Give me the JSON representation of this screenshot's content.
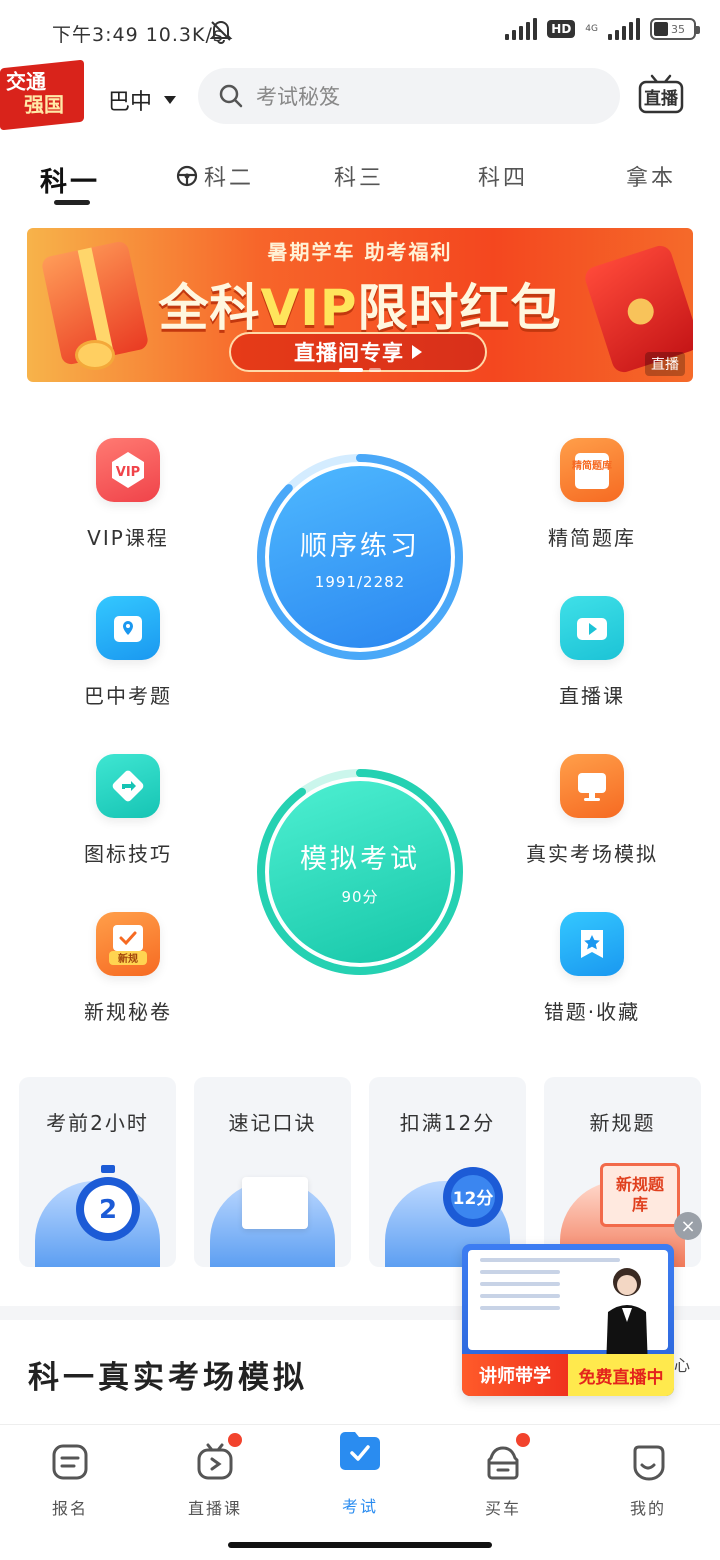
{
  "status_bar": {
    "time": "下午3:49 10.3K/s",
    "hd": "HD",
    "net": "4G",
    "battery": "35"
  },
  "header": {
    "logo_line1": "交通",
    "logo_line2": "强国",
    "city": "巴中",
    "search_placeholder": "考试秘笈",
    "live_label": "直播"
  },
  "tabs": [
    {
      "label": "科一"
    },
    {
      "label": "科二"
    },
    {
      "label": "科三"
    },
    {
      "label": "科四"
    },
    {
      "label": "拿本"
    }
  ],
  "banner": {
    "topline": "暑期学车 助考福利",
    "headline_pre": "全科",
    "headline_vip": "VIP",
    "headline_post": "限时红包",
    "cta": "直播间专享",
    "badge": "直播"
  },
  "features": {
    "vip_course": "VIP课程",
    "simple_bank": "精简题库",
    "local_questions": "巴中考题",
    "live_class": "直播课",
    "sign_tips": "图标技巧",
    "real_exam": "真实考场模拟",
    "new_rules": "新规秘卷",
    "wrong_fav": "错题·收藏"
  },
  "icon_text": {
    "vip": "VIP",
    "simple_bank": "精简题库",
    "new_rules": "新规"
  },
  "practice": {
    "title": "顺序练习",
    "progress": "1991/2282",
    "progress_fraction": 0.872
  },
  "mock_exam": {
    "title": "模拟考试",
    "score": "90分",
    "score_fraction": 0.9
  },
  "cards": [
    {
      "title": "考前2小时",
      "art": "2"
    },
    {
      "title": "速记口诀",
      "art": ""
    },
    {
      "title": "扣满12分",
      "art": "12分"
    },
    {
      "title": "新规题",
      "art": "新规题库"
    }
  ],
  "section_title": "科一真实考场模拟",
  "live_float": {
    "left": "讲师带学",
    "right": "免费直播中",
    "close": "×",
    "peek": "心"
  },
  "bottom_nav": [
    {
      "label": "报名"
    },
    {
      "label": "直播课"
    },
    {
      "label": "考试"
    },
    {
      "label": "买车"
    },
    {
      "label": "我的"
    }
  ]
}
